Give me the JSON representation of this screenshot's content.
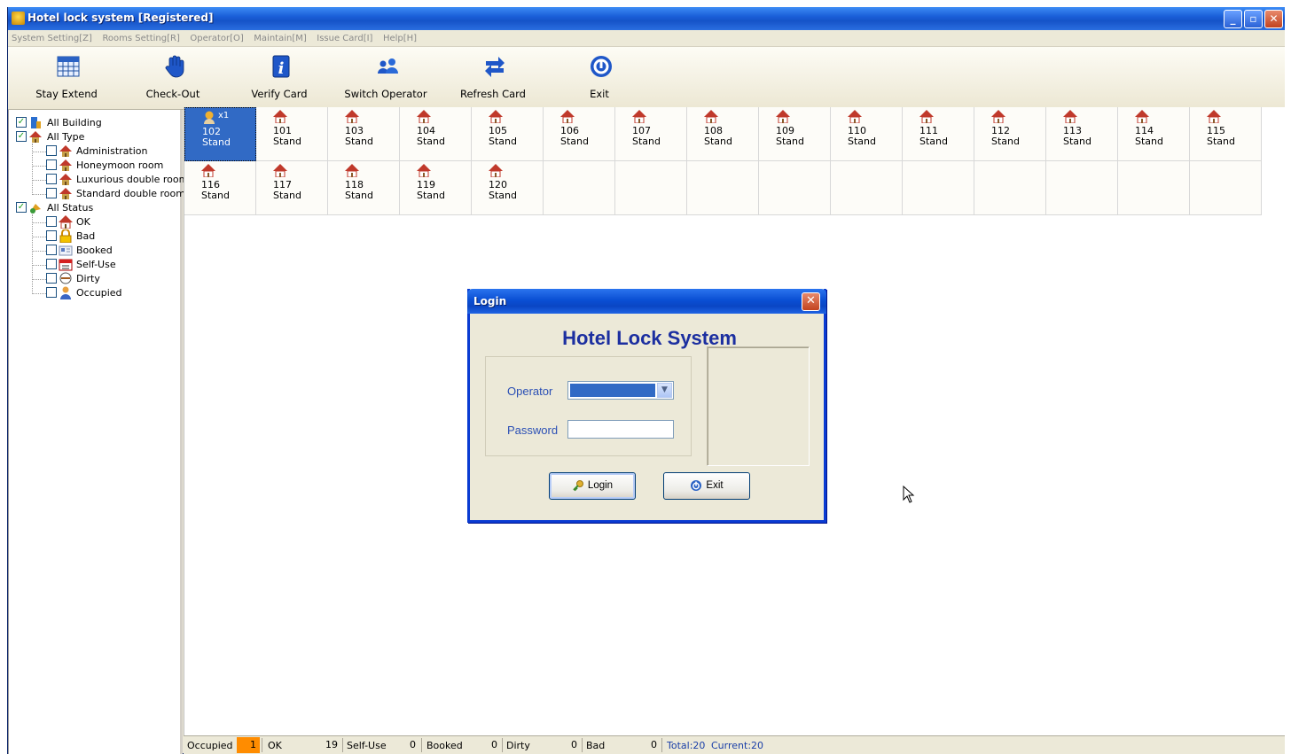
{
  "window": {
    "title": "Hotel lock system [Registered]"
  },
  "menu": [
    "System Setting[Z]",
    "Rooms Setting[R]",
    "Operator[O]",
    "Maintain[M]",
    "Issue Card[I]",
    "Help[H]"
  ],
  "toolbar": [
    {
      "label": "Stay Extend",
      "icon": "calendar-icon"
    },
    {
      "label": "Check-Out",
      "icon": "hand-icon"
    },
    {
      "label": "Verify Card",
      "icon": "info-icon"
    },
    {
      "label": "Switch Operator",
      "icon": "users-icon"
    },
    {
      "label": "Refresh Card",
      "icon": "refresh-icon"
    },
    {
      "label": "Exit",
      "icon": "power-icon"
    }
  ],
  "tree": {
    "building": {
      "label": "All Building",
      "checked": true
    },
    "type": {
      "label": "All Type",
      "checked": true,
      "children": [
        "Administration",
        "Honeymoon room",
        "Luxurious double room",
        "Standard double room"
      ]
    },
    "status": {
      "label": "All Status",
      "checked": true,
      "children": [
        "OK",
        "Bad",
        "Booked",
        "Self-Use",
        "Dirty",
        "Occupied"
      ]
    }
  },
  "rooms": [
    {
      "num": "102",
      "status": "Stand",
      "count": "x1",
      "selected": true
    },
    {
      "num": "101",
      "status": "Stand"
    },
    {
      "num": "103",
      "status": "Stand"
    },
    {
      "num": "104",
      "status": "Stand"
    },
    {
      "num": "105",
      "status": "Stand"
    },
    {
      "num": "106",
      "status": "Stand"
    },
    {
      "num": "107",
      "status": "Stand"
    },
    {
      "num": "108",
      "status": "Stand"
    },
    {
      "num": "109",
      "status": "Stand"
    },
    {
      "num": "110",
      "status": "Stand"
    },
    {
      "num": "111",
      "status": "Stand"
    },
    {
      "num": "112",
      "status": "Stand"
    },
    {
      "num": "113",
      "status": "Stand"
    },
    {
      "num": "114",
      "status": "Stand"
    },
    {
      "num": "115",
      "status": "Stand"
    },
    {
      "num": "116",
      "status": "Stand"
    },
    {
      "num": "117",
      "status": "Stand"
    },
    {
      "num": "118",
      "status": "Stand"
    },
    {
      "num": "119",
      "status": "Stand"
    },
    {
      "num": "120",
      "status": "Stand"
    }
  ],
  "statusbar": {
    "items": [
      {
        "label": "Occupied",
        "value": "1",
        "highlight": true
      },
      {
        "label": "OK",
        "value": "19"
      },
      {
        "label": "Self-Use",
        "value": "0"
      },
      {
        "label": "Booked",
        "value": "0"
      },
      {
        "label": "Dirty",
        "value": "0"
      },
      {
        "label": "Bad",
        "value": "0"
      }
    ],
    "total": "Total:20",
    "current": "Current:20"
  },
  "login": {
    "title": "Login",
    "heading": "Hotel Lock System",
    "operator_label": "Operator",
    "password_label": "Password",
    "login_button": "Login",
    "exit_button": "Exit"
  },
  "colors": {
    "titlebar": "#1553c8",
    "selection": "#316ac5",
    "highlight": "#ff8c00",
    "heading": "#1c2fa0",
    "house": "#c0392b"
  }
}
